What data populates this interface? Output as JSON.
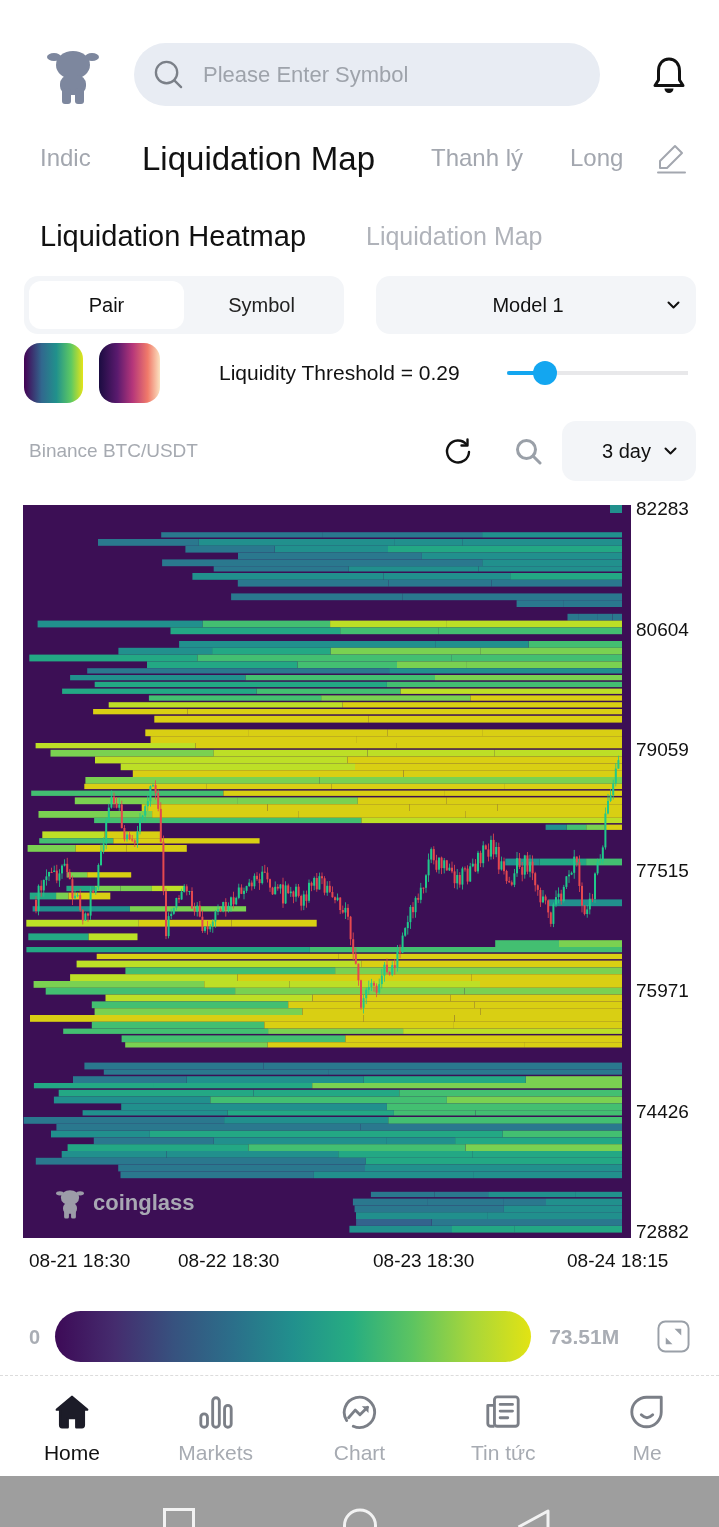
{
  "header": {
    "search": {
      "placeholder": "Please Enter Symbol"
    }
  },
  "tabs": [
    {
      "label": "Indic",
      "selected": false
    },
    {
      "label": "Liquidation Map",
      "selected": true
    },
    {
      "label": "Thanh lý",
      "selected": false
    },
    {
      "label": "Long",
      "selected": false
    }
  ],
  "sub_tabs": [
    {
      "label": "Liquidation Heatmap",
      "selected": true
    },
    {
      "label": "Liquidation Map",
      "selected": false
    }
  ],
  "type_toggle": [
    {
      "label": "Pair",
      "selected": true
    },
    {
      "label": "Symbol",
      "selected": false
    }
  ],
  "model_select": {
    "value": "Model 1"
  },
  "threshold": {
    "label": "Liquidity Threshold = 0.29",
    "level": 0.21
  },
  "market": {
    "label": "Binance BTC/USDT",
    "period": "3 day"
  },
  "chart": {
    "y_axis_labels": [
      "82283",
      "80604",
      "79059",
      "77515",
      "75971",
      "74426",
      "72882"
    ],
    "x_axis_labels": [
      "08-21 18:30",
      "08-22 18:30",
      "08-23 18:30",
      "08-24 18:15"
    ],
    "logo_text": "coinglass"
  },
  "legend": {
    "min": "0",
    "max": "73.51M"
  },
  "bottom_nav": [
    {
      "label": "Home",
      "selected": true
    },
    {
      "label": "Markets",
      "selected": false
    },
    {
      "label": "Chart",
      "selected": false
    },
    {
      "label": "Tin tức",
      "selected": false
    },
    {
      "label": "Me",
      "selected": false
    }
  ]
}
